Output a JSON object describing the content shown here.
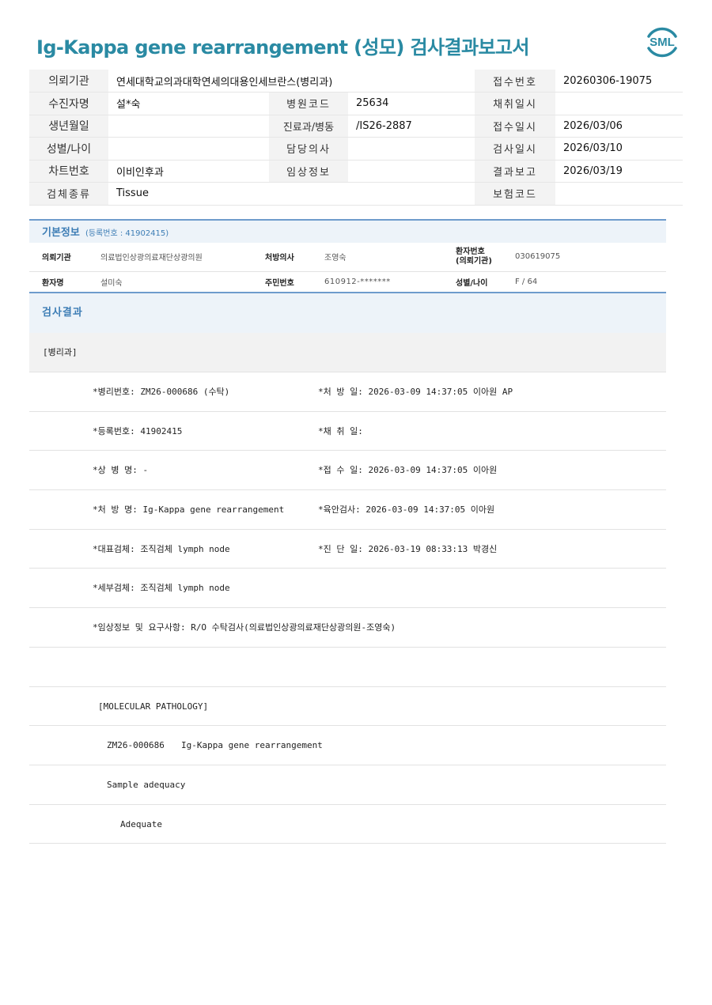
{
  "report": {
    "title": "Ig-Kappa gene rearrangement (성모) 검사결과보고서",
    "logo_text": "SML",
    "brand_color": "#2a8aa3"
  },
  "header": {
    "rows": [
      [
        {
          "label": "의뢰기관",
          "value": "연세대학교의과대학연세의대용인세브란스(병리과)"
        },
        {
          "label": "접수번호",
          "value": "20260306-19075"
        }
      ],
      [
        {
          "label": "수진자명",
          "value": "설*숙"
        },
        {
          "label": "병원코드",
          "value": "25634"
        },
        {
          "label": "채취일시",
          "value": ""
        }
      ],
      [
        {
          "label": "생년월일",
          "value": ""
        },
        {
          "label": "진료과/병동",
          "value": "/IS26-2887"
        },
        {
          "label": "접수일시",
          "value": "2026/03/06"
        }
      ],
      [
        {
          "label": "성별/나이",
          "value": ""
        },
        {
          "label": "담당의사",
          "value": ""
        },
        {
          "label": "검사일시",
          "value": "2026/03/10"
        }
      ],
      [
        {
          "label": "차트번호",
          "value": "이비인후과"
        },
        {
          "label": "임상정보",
          "value": ""
        },
        {
          "label": "결과보고",
          "value": "2026/03/19"
        }
      ],
      [
        {
          "label": "검체종류",
          "value": "Tissue"
        },
        {
          "label": "보험코드",
          "value": ""
        }
      ]
    ]
  },
  "basic_info": {
    "title": "기본정보",
    "subtitle": "(등록번호 : 41902415)",
    "institution_label": "의뢰기관",
    "institution": "의료법인상광의료재단상광의원",
    "doctor_label": "처방의사",
    "doctor": "조영숙",
    "patient_no_label_1": "환자번호",
    "patient_no_label_2": "(의뢰기관)",
    "patient_no": "030619075",
    "patient_name_label": "환자명",
    "patient_name": "설미숙",
    "resident_no_label": "주민번호",
    "resident_no": "610912-*******",
    "sex_age_label": "성별/나이",
    "sex_age": "F / 64"
  },
  "results": {
    "title": "검사결과",
    "dept": "[병리과]",
    "lines": [
      {
        "left": "*병리번호: ZM26-000686 (수탁)",
        "right": "*처 방 일: 2026-03-09 14:37:05  이아원 AP"
      },
      {
        "left": "*등록번호: 41902415",
        "right": "*채 취 일:"
      },
      {
        "left": "*상 병 명: -",
        "right": "*접 수 일: 2026-03-09 14:37:05  이아원"
      },
      {
        "left": "*처 방 명: Ig-Kappa gene rearrangement",
        "right": "*육안검사: 2026-03-09 14:37:05  이아원"
      },
      {
        "left": "*대표검체: 조직검체 lymph node",
        "right": "*진 단 일: 2026-03-19 08:33:13  박경신"
      },
      {
        "left": "*세부검체: 조직검체 lymph node",
        "right": ""
      },
      {
        "left": "*임상정보 및 요구사항: R/O 수탁검사(의료법인상광의료재단상광의원-조영숙)",
        "right": ""
      }
    ],
    "molecular_header": "[MOLECULAR PATHOLOGY]",
    "molecular_code": "ZM26-000686",
    "molecular_test": "Ig-Kappa gene rearrangement",
    "sample_adequacy_label": "Sample adequacy",
    "sample_adequacy_value": "Adequate"
  }
}
